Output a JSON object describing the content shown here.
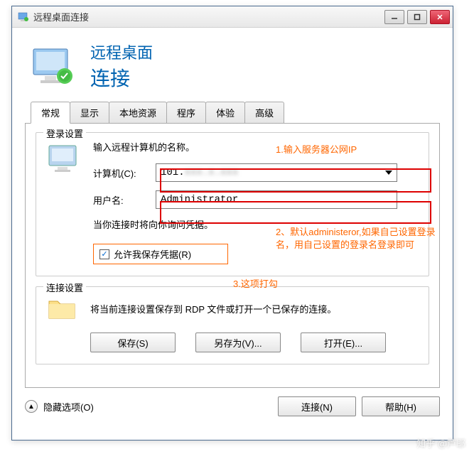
{
  "window": {
    "title": "远程桌面连接"
  },
  "header": {
    "line1": "远程桌面",
    "line2": "连接"
  },
  "tabs": [
    "常规",
    "显示",
    "本地资源",
    "程序",
    "体验",
    "高级"
  ],
  "login": {
    "legend": "登录设置",
    "instruction": "输入远程计算机的名称。",
    "computer_label": "计算机(C):",
    "computer_value": "101.",
    "computer_value_blur": "xxx.x.xxx",
    "username_label": "用户名:",
    "username_value": "Administrator",
    "cred_note": "当你连接时将向你询问凭据。",
    "save_cred_label": "允许我保存凭据(R)"
  },
  "conn": {
    "legend": "连接设置",
    "text": "将当前连接设置保存到 RDP 文件或打开一个已保存的连接。",
    "save_btn": "保存(S)",
    "saveas_btn": "另存为(V)...",
    "open_btn": "打开(E)..."
  },
  "footer": {
    "options": "隐藏选项(O)",
    "connect_btn": "连接(N)",
    "help_btn": "帮助(H)"
  },
  "annotations": {
    "a1": "1.输入服务器公网IP",
    "a2": "2、默认administeror,如果自己设置登录名，用自己设置的登录名登录即可",
    "a3": "3.这项打勾"
  },
  "watermark": "知乎 @芦耶"
}
